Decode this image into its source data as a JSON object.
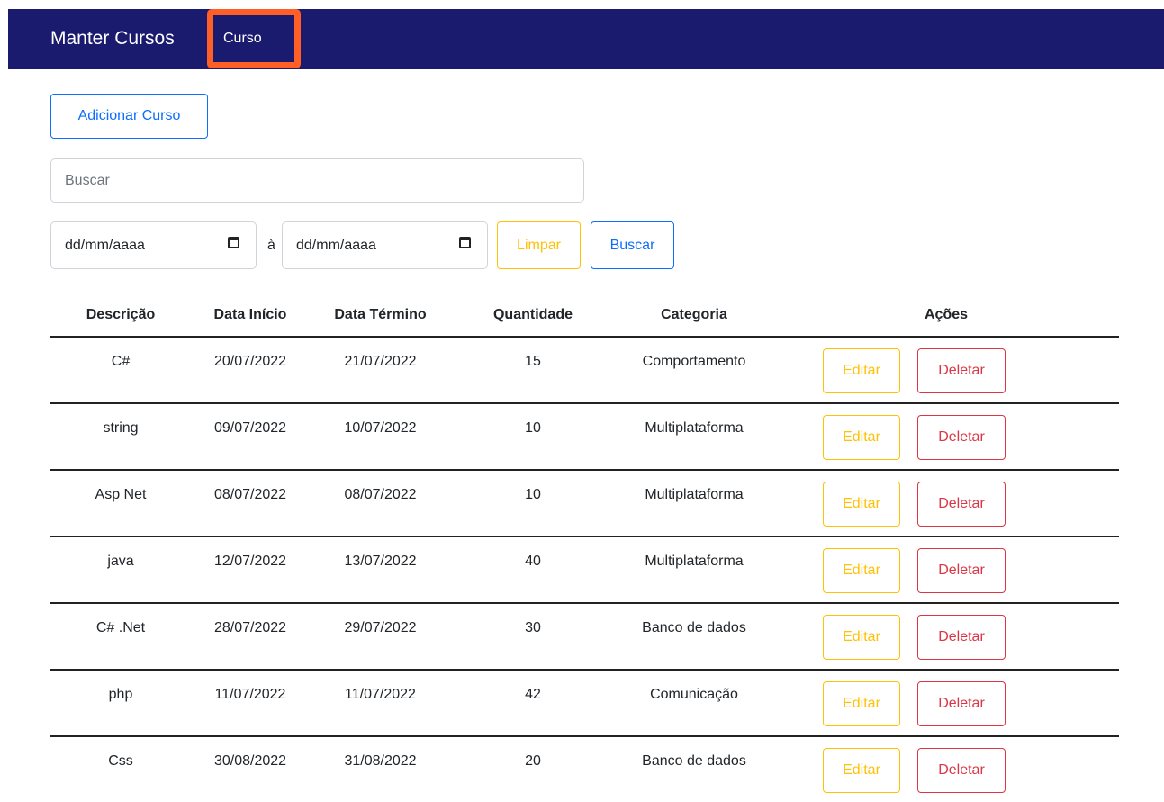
{
  "navbar": {
    "brand": "Manter Cursos",
    "link": "Curso",
    "bg_color": "#1a1a6e",
    "highlight_color": "#ff5e24"
  },
  "toolbar": {
    "add_label": "Adicionar Curso",
    "search_placeholder": "Buscar",
    "date_start_placeholder": "dd/mm/aaaa",
    "date_separator": "à",
    "date_end_placeholder": "dd/mm/aaaa",
    "clear_label": "Limpar",
    "search_label": "Buscar"
  },
  "table": {
    "headers": [
      "Descrição",
      "Data Início",
      "Data Término",
      "Quantidade",
      "Categoria",
      "Ações"
    ],
    "edit_label": "Editar",
    "delete_label": "Deletar",
    "rows": [
      {
        "descricao": "C#",
        "inicio": "20/07/2022",
        "termino": "21/07/2022",
        "quantidade": "15",
        "categoria": "Comportamento"
      },
      {
        "descricao": "string",
        "inicio": "09/07/2022",
        "termino": "10/07/2022",
        "quantidade": "10",
        "categoria": "Multiplataforma"
      },
      {
        "descricao": "Asp Net",
        "inicio": "08/07/2022",
        "termino": "08/07/2022",
        "quantidade": "10",
        "categoria": "Multiplataforma"
      },
      {
        "descricao": "java",
        "inicio": "12/07/2022",
        "termino": "13/07/2022",
        "quantidade": "40",
        "categoria": "Multiplataforma"
      },
      {
        "descricao": "C# .Net",
        "inicio": "28/07/2022",
        "termino": "29/07/2022",
        "quantidade": "30",
        "categoria": "Banco de dados"
      },
      {
        "descricao": "php",
        "inicio": "11/07/2022",
        "termino": "11/07/2022",
        "quantidade": "42",
        "categoria": "Comunicação"
      },
      {
        "descricao": "Css",
        "inicio": "30/08/2022",
        "termino": "31/08/2022",
        "quantidade": "20",
        "categoria": "Banco de dados"
      }
    ]
  },
  "colors": {
    "primary": "#0d6efd",
    "warning": "#ffc107",
    "danger": "#dc3545"
  }
}
